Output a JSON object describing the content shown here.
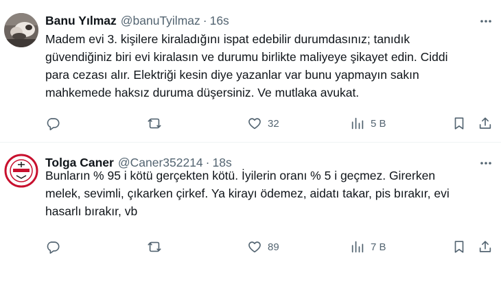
{
  "tweets": [
    {
      "display_name": "Banu Yılmaz",
      "handle": "@banuTyilmaz",
      "separator": "·",
      "time": "16s",
      "text": "Madem evi 3. kişilere kiraladığını ispat edebilir durumdasınız; tanıdık\ngüvendiğiniz biri evi kiralasın ve durumu birlikte maliyeye şikayet edin. Ciddi\npara cezası alır. Elektriği kesin diye yazanlar var bunu yapmayın sakın\nmahkemede haksız duruma düşersiniz. Ve mutlaka avukat.",
      "likes": "32",
      "views": "5 B",
      "icons": [
        "reply-icon",
        "retweet-icon",
        "like-icon",
        "views-icon",
        "bookmark-icon",
        "share-icon",
        "more-icon"
      ]
    },
    {
      "display_name": "Tolga Caner",
      "handle": "@Caner352214",
      "separator": "·",
      "time": "18s",
      "text": "Bunların % 95 i kötü gerçekten kötü. İyilerin oranı % 5 i geçmez. Girerken\nmelek, sevimli, çıkarken çirkef. Ya kirayı ödemez, aidatı takar, pis bırakır, evi\nhasarlı bırakır, vb",
      "likes": "89",
      "views": "7 B",
      "icons": [
        "reply-icon",
        "retweet-icon",
        "like-icon",
        "views-icon",
        "bookmark-icon",
        "share-icon",
        "more-icon"
      ]
    }
  ],
  "colors": {
    "text_primary": "#0f1419",
    "text_secondary": "#536471",
    "divider": "#eff3f4",
    "badge_red": "#c8102e"
  }
}
